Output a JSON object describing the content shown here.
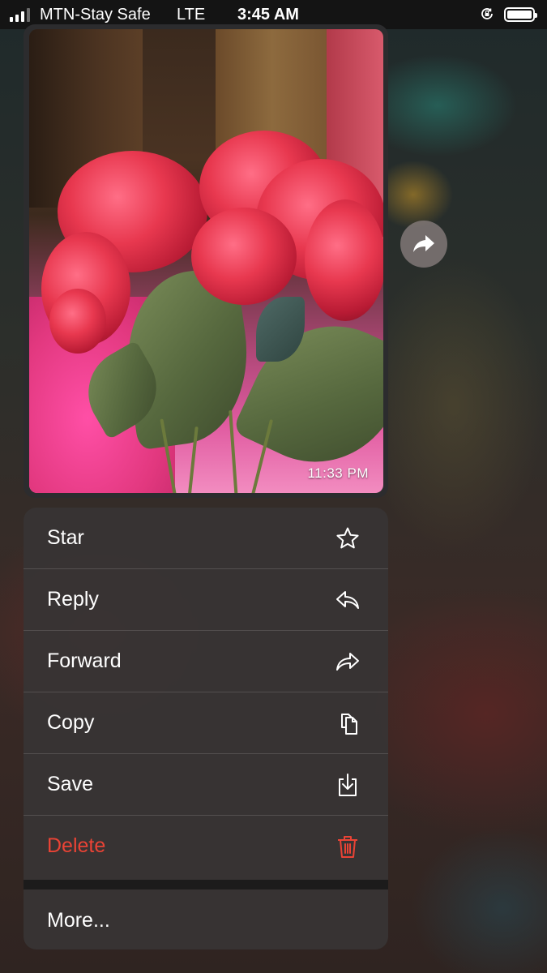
{
  "status_bar": {
    "carrier": "MTN-Stay Safe",
    "network": "LTE",
    "time": "3:45 AM",
    "signal_bars": 4,
    "signal_bars_active": 3
  },
  "message": {
    "timestamp": "11:33 PM"
  },
  "menu": {
    "star": "Star",
    "reply": "Reply",
    "forward": "Forward",
    "copy": "Copy",
    "save": "Save",
    "delete": "Delete",
    "more": "More..."
  },
  "colors": {
    "destructive": "#ea4335",
    "menu_background": "#373434"
  }
}
